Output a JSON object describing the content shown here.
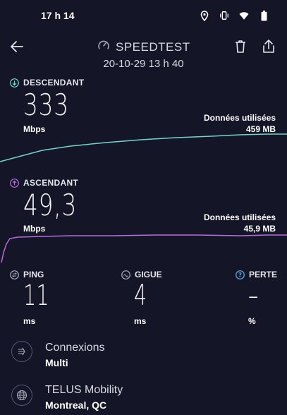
{
  "status": {
    "time": "17 h 14",
    "icons": [
      "location-icon",
      "vibrate-icon",
      "wifi-icon",
      "battery-icon"
    ]
  },
  "header": {
    "title": "SPEEDTEST",
    "datetime": "20-10-29 13 h 40"
  },
  "download": {
    "label": "DESCENDANT",
    "value": "333",
    "unit": "Mbps",
    "data_used_label": "Données utilisées",
    "data_used_value": "459 MB",
    "color": "#6fd6cc"
  },
  "upload": {
    "label": "ASCENDANT",
    "value": "49,3",
    "unit": "Mbps",
    "data_used_label": "Données utilisées",
    "data_used_value": "45,9 MB",
    "color": "#b46de0"
  },
  "metrics": {
    "ping": {
      "label": "PING",
      "value": "11",
      "unit": "ms"
    },
    "jitter": {
      "label": "GIGUE",
      "value": "4",
      "unit": "ms"
    },
    "loss": {
      "label": "PERTE",
      "value": "–",
      "unit": "%"
    }
  },
  "connections": {
    "title": "Connexions",
    "value": "Multi"
  },
  "server": {
    "title": "TELUS Mobility",
    "location": "Montreal, QC"
  },
  "colors": {
    "background": "#141526",
    "accent_blue": "#5ab0e8"
  }
}
